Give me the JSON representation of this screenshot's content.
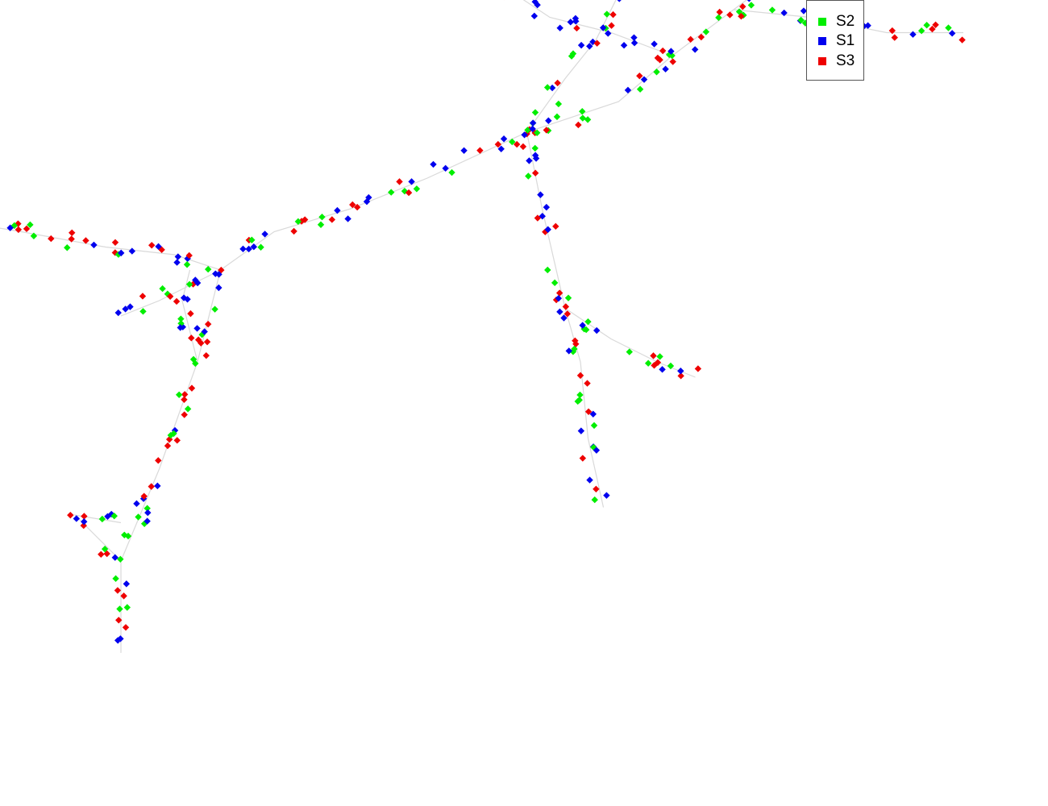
{
  "chart_data": {
    "type": "scatter",
    "title": "",
    "xlabel": "",
    "ylabel": "",
    "axes_shown": false,
    "grid": false,
    "legend_position": "top-right",
    "edge_color": "#d9d9d9",
    "tree_edges": [
      [
        [
          -2.0,
          -5.0
        ],
        [
          -2.0,
          -3.8
        ],
        [
          -1.5,
          -2.6
        ],
        [
          -1.0,
          -1.2
        ],
        [
          -0.7,
          0.0
        ],
        [
          0.0,
          0.5
        ],
        [
          1.0,
          0.8
        ],
        [
          2.0,
          1.2
        ],
        [
          3.3,
          1.8
        ],
        [
          4.5,
          2.2
        ],
        [
          5.2,
          2.8
        ]
      ],
      [
        [
          -2.0,
          -3.8
        ],
        [
          -2.6,
          -3.2
        ],
        [
          -2.0,
          -3.3
        ]
      ],
      [
        [
          -1.0,
          -1.2
        ],
        [
          -1.2,
          -0.4
        ],
        [
          -1.1,
          0.0
        ]
      ],
      [
        [
          -0.7,
          0.0
        ],
        [
          -1.3,
          0.2
        ],
        [
          -2.2,
          0.3
        ],
        [
          -3.3,
          0.5
        ],
        [
          -3.9,
          0.6
        ]
      ],
      [
        [
          -0.7,
          0.0
        ],
        [
          -1.5,
          -0.4
        ],
        [
          -2.0,
          -0.6
        ]
      ],
      [
        [
          5.2,
          2.8
        ],
        [
          6.0,
          3.4
        ],
        [
          6.8,
          4.0
        ],
        [
          7.6,
          4.8
        ],
        [
          8.3,
          5.3
        ]
      ],
      [
        [
          6.0,
          3.4
        ],
        [
          7.0,
          3.3
        ],
        [
          8.0,
          3.1
        ],
        [
          9.0,
          3.1
        ]
      ],
      [
        [
          5.2,
          2.8
        ],
        [
          4.4,
          3.1
        ],
        [
          3.6,
          3.3
        ],
        [
          3.0,
          3.7
        ],
        [
          2.4,
          4.3
        ],
        [
          2.0,
          4.8
        ]
      ],
      [
        [
          3.3,
          1.8
        ],
        [
          3.5,
          0.8
        ],
        [
          3.8,
          -0.5
        ],
        [
          4.0,
          -1.2
        ],
        [
          4.1,
          -2.2
        ],
        [
          4.3,
          -3.1
        ]
      ],
      [
        [
          3.8,
          -0.5
        ],
        [
          4.4,
          -0.9
        ],
        [
          5.0,
          -1.2
        ],
        [
          5.5,
          -1.4
        ]
      ],
      [
        [
          3.3,
          1.8
        ],
        [
          3.8,
          2.5
        ],
        [
          4.2,
          3.0
        ],
        [
          4.6,
          3.8
        ],
        [
          4.9,
          4.1
        ]
      ]
    ],
    "series": [
      {
        "name": "S2",
        "color": "#00ee00"
      },
      {
        "name": "S1",
        "color": "#0000ee"
      },
      {
        "name": "S3",
        "color": "#ee0000"
      }
    ]
  }
}
